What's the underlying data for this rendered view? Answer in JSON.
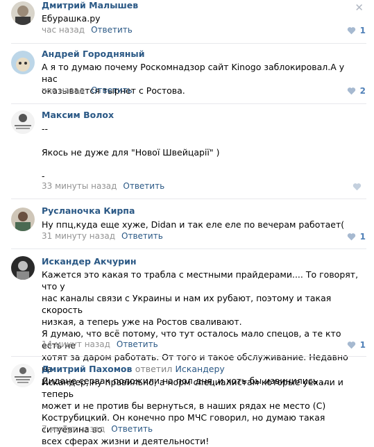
{
  "comments": [
    {
      "author": "Дмитрий Малышев",
      "lines": [
        "Ебурашка.ру"
      ],
      "time": "час назад",
      "reply": "Ответить",
      "likes": "1"
    },
    {
      "author": "Андрей Городняный",
      "lines": [
        "А я то думаю почему Роскомнадзор сайт Kinogo заблокировал.А у нас",
        "оказывается тырнет с Ростова."
      ],
      "time": "час назад",
      "reply": "Ответить",
      "likes": "2"
    },
    {
      "author": "Максим Волох",
      "lines": [
        "--",
        "",
        "Якось не дуже для \"Нової Швейцарії\" )",
        "",
        "-"
      ],
      "time": "33 минуты назад",
      "reply": "Ответить",
      "likes": ""
    },
    {
      "author": "Русланочка Кирпа",
      "lines": [
        "Ну ппц,куда еще хуже, Didan и так еле еле по вечерам работает("
      ],
      "time": "31 минуту назад",
      "reply": "Ответить",
      "likes": "1"
    },
    {
      "author": "Искандер Акчурин",
      "lines": [
        "Кажется это какая то трабла с местными прайдерами.... То говорят, что у",
        "нас каналы связи с Украины и нам их рубают, поэтому и такая скорость",
        "низкая, а теперь уже на Ростов сваливают.",
        "Я думаю, что всё потому, что тут осталось мало спецов, а те кто есть не",
        "хотят за даром работать. От того и такое обслуживание. Недавно на",
        "Дидане сервак положили на пол дня, и хоть бы извинились ..."
      ],
      "time": "14 минут назад",
      "reply": "Ответить",
      "likes": "1"
    },
    {
      "author": "Дмитрий Пахомов",
      "replied_word": "ответил",
      "replied_to": "Искандеру",
      "lines": [
        "Искандер, ну правильно, а норм специалистам которые уехали и теперь",
        "может и не против бы вернуться, в наших рядах не место (С)",
        "Кострубицкий. Он конечно про МЧС говорил, но думаю такая ситуёвина во",
        "всех сферах жизни и деятельности!"
      ],
      "time": "7 минут назад",
      "reply": "Ответить",
      "likes": ""
    }
  ],
  "icons": {
    "close": "close-icon",
    "like": "heart-icon"
  },
  "colors": {
    "link": "#2a5885",
    "muted": "#939393",
    "like": "#5181b8",
    "divider": "#e7e8ec"
  }
}
